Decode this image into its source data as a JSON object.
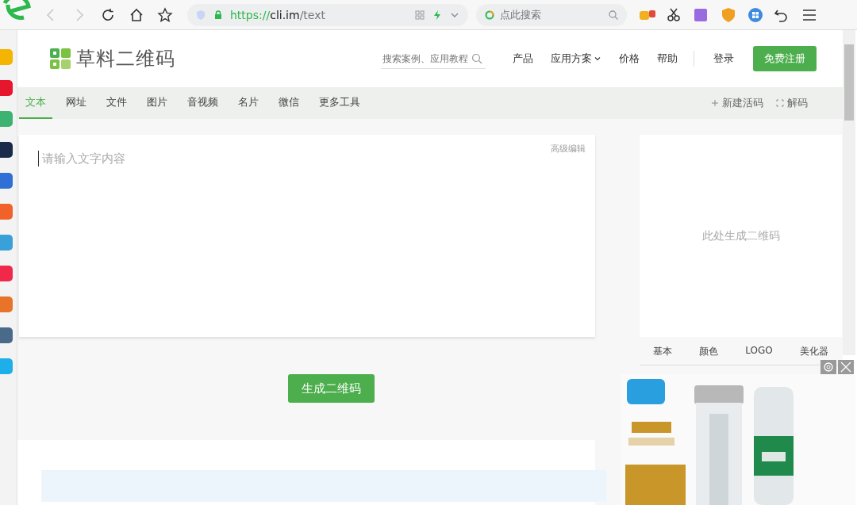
{
  "browser": {
    "back_disabled": true,
    "forward_disabled": true,
    "url": {
      "scheme": "https://",
      "host": "cli.im",
      "path": "/text"
    },
    "search": {
      "placeholder": "点此搜索"
    }
  },
  "sidebar": {
    "apps": [
      {
        "color": "#f5b400"
      },
      {
        "color": "#e6162d"
      },
      {
        "color": "#3cb371"
      },
      {
        "color": "#1a2a4a"
      },
      {
        "color": "#2f6fd6"
      },
      {
        "color": "#f0622a"
      },
      {
        "color": "#3aa0d8"
      },
      {
        "color": "#f0284a"
      },
      {
        "color": "#e8742a"
      },
      {
        "color": "#4a6a8a"
      },
      {
        "color": "#1eaee8"
      }
    ]
  },
  "header": {
    "logo": "草料二维码",
    "search": {
      "placeholder": "搜索案例、应用教程"
    },
    "nav": [
      {
        "label": "产品",
        "dropdown": false
      },
      {
        "label": "应用方案",
        "dropdown": true
      },
      {
        "label": "价格",
        "dropdown": false
      },
      {
        "label": "帮助",
        "dropdown": false
      }
    ],
    "login": "登录",
    "register": "免费注册"
  },
  "tabs": [
    {
      "label": "文本",
      "selected": true
    },
    {
      "label": "网址",
      "selected": false
    },
    {
      "label": "文件",
      "selected": false
    },
    {
      "label": "图片",
      "selected": false
    },
    {
      "label": "音视频",
      "selected": false
    },
    {
      "label": "名片",
      "selected": false
    },
    {
      "label": "微信",
      "selected": false
    },
    {
      "label": "更多工具",
      "selected": false
    }
  ],
  "tab_actions": [
    {
      "kind": "new",
      "label": "新建活码"
    },
    {
      "kind": "decode",
      "label": "解码"
    }
  ],
  "editor": {
    "placeholder": "请输入文字内容",
    "advanced": "高级编辑"
  },
  "generate_button": "生成二维码",
  "preview": {
    "placeholder": "此处生成二维码",
    "tabs": [
      {
        "label": "基本"
      },
      {
        "label": "颜色"
      },
      {
        "label": "LOGO"
      },
      {
        "label": "美化器"
      }
    ]
  }
}
